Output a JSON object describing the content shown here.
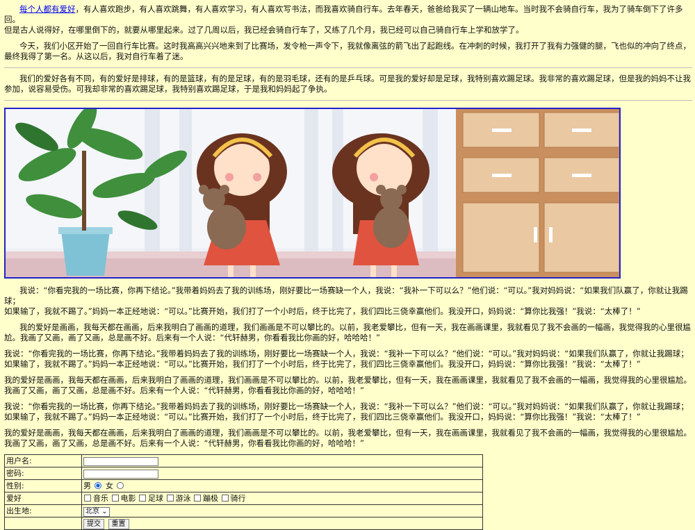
{
  "intro": {
    "link": "每个人都有爱好",
    "rest": "，有人喜欢跑步，有人喜欢跳舞，有人喜欢学习，有人喜欢写书法，而我喜欢骑自行车。去年春天，爸爸给我买了一辆山地车。当时我不会骑自行车，我为了骑车倒下了许多回。",
    "line2": "但是古人说得好，在哪里倒下的，就要从哪里起来。过了几周以后，我已经会骑自行车了，又练了几个月，我已经可以自己骑自行车上学和放学了。"
  },
  "para_race": "今天，我们小区开始了一回自行车比赛。这时我高高兴兴地来到了比赛场，发令枪一声令下，我就像离弦的箭飞出了起跑线。在冲刺的时候，我打开了我有力强健的腿，飞也似的冲向了终点，最终我得了第一名。从这以后，我对自行车着了迷。",
  "para_soccer": "我们的爱好各有不同，有的爱好是排球，有的是篮球，有的是足球，有的是羽毛球，还有的是乒乓球。可是我的爱好却是足球，我特别喜欢踢足球。我非常的喜欢踢足球，但是我的妈妈不让我参加，说容易受伤。可我却非常的喜欢踢足球，我特别喜欢踢足球，于是我和妈妈起了争执。",
  "dialog": {
    "line1": "我说：“你看完我的一场比赛，你再下结论。”我带着妈妈去了我的训练场，刚好要比一场赛缺一个人，我说：“我补一下可以么？”他们说：“可以。”我对妈妈说：“如果我们队赢了，你就让我踢球；",
    "line2": "如果输了，我就不踢了。”妈妈一本正经地说：“可以。”比赛开始，我们打了一个小时后，终于比完了，我们四比三侥幸赢他们。我没开口，妈妈说：“算你比我强！”我说：“太棒了！”"
  },
  "painting": {
    "line1": "我的爱好是画画，我每天都在画画，后来我明白了画画的道理，我们画画是不可以攀比的。以前，我老爱攀比，但有一天，我在画画课里，我就看见了我不会画的一幅画，我觉得我的心里很尴尬。我画了又画，画了又画，总是画不好。后来有一个人说：“代轩赫男，你看看我比你画的好，哈哈哈！”",
    "line2": "我的爱好是画画，我每天都在画画，后来我明白了画画的道理，我们画画是不可以攀比的。以前，我老爱攀比，但有一天，我在画画课里，我就看见了我不会画的一幅画，我觉得我的心里很尴尬。我画了又画，画了又画，总是画不好。后来有一个人说：“代轩赫男，你看看我比你画的好，哈哈哈！”"
  },
  "form": {
    "username_label": "用户名:",
    "password_label": "密码:",
    "gender_label": "性别:",
    "gender_male": "男",
    "gender_female": "女",
    "hobby_label": "爱好",
    "hobbies": [
      "音乐",
      "电影",
      "足球",
      "游泳",
      "蹦极",
      "骑行"
    ],
    "birthplace_label": "出生地:",
    "birthplace_value": "北京",
    "submit": "提交",
    "reset": "重置"
  },
  "colors": {
    "background": "#ffffcc",
    "link": "#0000ee",
    "image_border": "#2222cc"
  }
}
